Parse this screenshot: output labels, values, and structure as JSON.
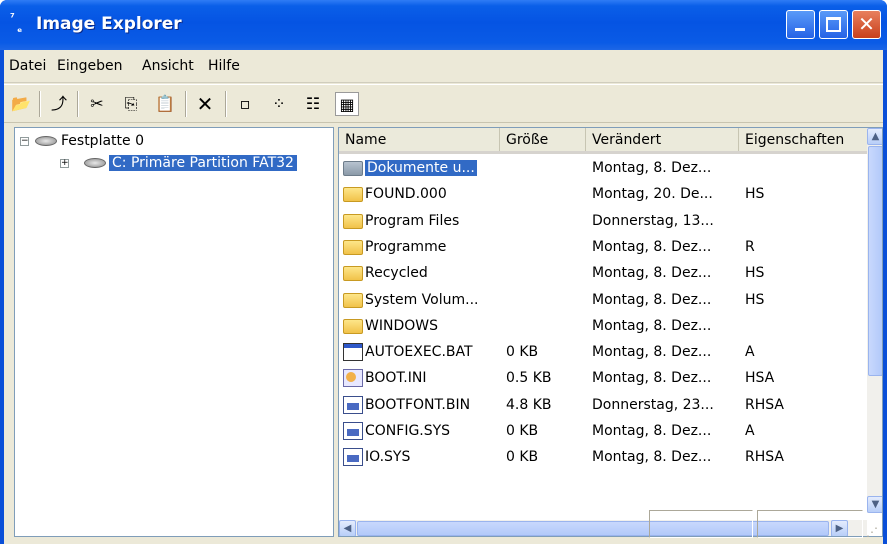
{
  "window": {
    "title": "Image Explorer"
  },
  "menu": [
    "Datei",
    "Eingeben",
    "Ansicht",
    "Hilfe"
  ],
  "toolbar": {
    "icons": [
      "open-folder",
      "up-folder",
      "cut",
      "copy",
      "paste",
      "delete",
      "view-large-icons",
      "view-small-icons",
      "view-list",
      "view-details"
    ]
  },
  "tree": {
    "root": "Festplatte 0",
    "child": "C: Primäre Partition FAT32"
  },
  "list": {
    "columns": [
      "Name",
      "Größe",
      "Verändert",
      "Eigenschaften"
    ],
    "rows": [
      {
        "name": "Dokumente u...",
        "size": "",
        "modified": "Montag, 8. Dez...",
        "attr": "",
        "icon": "folder-grey"
      },
      {
        "name": "FOUND.000",
        "size": "",
        "modified": "Montag, 20. De...",
        "attr": "HS",
        "icon": "folder"
      },
      {
        "name": "Program Files",
        "size": "",
        "modified": "Donnerstag, 13...",
        "attr": "",
        "icon": "folder"
      },
      {
        "name": "Programme",
        "size": "",
        "modified": "Montag, 8. Dez...",
        "attr": "R",
        "icon": "folder"
      },
      {
        "name": "Recycled",
        "size": "",
        "modified": "Montag, 8. Dez...",
        "attr": "HS",
        "icon": "folder"
      },
      {
        "name": "System Volum...",
        "size": "",
        "modified": "Montag, 8. Dez...",
        "attr": "HS",
        "icon": "folder"
      },
      {
        "name": "WINDOWS",
        "size": "",
        "modified": "Montag, 8. Dez...",
        "attr": "",
        "icon": "folder"
      },
      {
        "name": "AUTOEXEC.BAT",
        "size": "0 KB",
        "modified": "Montag, 8. Dez...",
        "attr": "A",
        "icon": "bat"
      },
      {
        "name": "BOOT.INI",
        "size": "0.5 KB",
        "modified": "Montag, 8. Dez...",
        "attr": "HSA",
        "icon": "ini"
      },
      {
        "name": "BOOTFONT.BIN",
        "size": "4.8 KB",
        "modified": "Donnerstag, 23...",
        "attr": "RHSA",
        "icon": "sys"
      },
      {
        "name": "CONFIG.SYS",
        "size": "0 KB",
        "modified": "Montag, 8. Dez...",
        "attr": "A",
        "icon": "sys"
      },
      {
        "name": "IO.SYS",
        "size": "0 KB",
        "modified": "Montag, 8. Dez...",
        "attr": "RHSA",
        "icon": "sys"
      }
    ]
  }
}
